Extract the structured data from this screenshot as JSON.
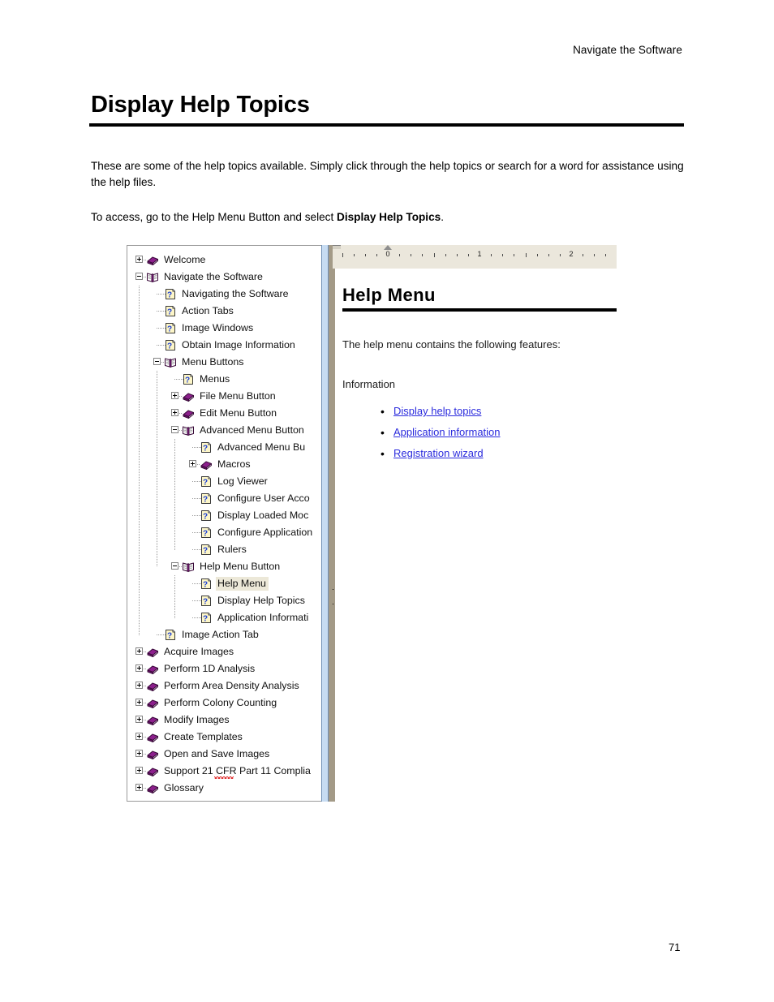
{
  "header": {
    "running_head": "Navigate the Software"
  },
  "title": "Display Help Topics",
  "paragraphs": {
    "intro": "These are some of the help topics available. Simply click through the help topics or search for a word for assistance using the help files.",
    "access_prefix": "To access, go to the Help Menu Button and select ",
    "access_bold": "Display Help Topics",
    "access_suffix": "."
  },
  "help_viewer": {
    "tree": {
      "items": [
        {
          "label": "Welcome",
          "depth": 0,
          "icon": "closed-book-icon",
          "expander": "plus",
          "selected": false
        },
        {
          "label": "Navigate the Software",
          "depth": 0,
          "icon": "open-book-icon",
          "expander": "minus",
          "selected": false
        },
        {
          "label": "Navigating the Software",
          "depth": 1,
          "icon": "help-page-icon",
          "expander": "none",
          "selected": false
        },
        {
          "label": "Action Tabs",
          "depth": 1,
          "icon": "help-page-icon",
          "expander": "none",
          "selected": false
        },
        {
          "label": "Image Windows",
          "depth": 1,
          "icon": "help-page-icon",
          "expander": "none",
          "selected": false
        },
        {
          "label": "Obtain Image Information",
          "depth": 1,
          "icon": "help-page-icon",
          "expander": "none",
          "selected": false
        },
        {
          "label": "Menu Buttons",
          "depth": 1,
          "icon": "open-book-icon",
          "expander": "minus",
          "selected": false
        },
        {
          "label": "Menus",
          "depth": 2,
          "icon": "help-page-icon",
          "expander": "none",
          "selected": false
        },
        {
          "label": "File Menu Button",
          "depth": 2,
          "icon": "closed-book-icon",
          "expander": "plus",
          "selected": false
        },
        {
          "label": "Edit Menu Button",
          "depth": 2,
          "icon": "closed-book-icon",
          "expander": "plus",
          "selected": false
        },
        {
          "label": "Advanced Menu Button",
          "depth": 2,
          "icon": "open-book-icon",
          "expander": "minus",
          "selected": false
        },
        {
          "label": "Advanced Menu Bu",
          "depth": 3,
          "icon": "help-page-icon",
          "expander": "none",
          "selected": false
        },
        {
          "label": "Macros",
          "depth": 3,
          "icon": "closed-book-icon",
          "expander": "plus",
          "selected": false
        },
        {
          "label": "Log Viewer",
          "depth": 3,
          "icon": "help-page-icon",
          "expander": "none",
          "selected": false
        },
        {
          "label": "Configure User Acco",
          "depth": 3,
          "icon": "help-page-icon",
          "expander": "none",
          "selected": false
        },
        {
          "label": "Display Loaded Moc",
          "depth": 3,
          "icon": "help-page-icon",
          "expander": "none",
          "selected": false
        },
        {
          "label": "Configure Application",
          "depth": 3,
          "icon": "help-page-icon",
          "expander": "none",
          "selected": false
        },
        {
          "label": "Rulers",
          "depth": 3,
          "icon": "help-page-icon",
          "expander": "none",
          "selected": false
        },
        {
          "label": "Help Menu Button",
          "depth": 2,
          "icon": "open-book-icon",
          "expander": "minus",
          "selected": false
        },
        {
          "label": "Help Menu",
          "depth": 3,
          "icon": "help-page-icon",
          "expander": "none",
          "selected": true
        },
        {
          "label": "Display Help Topics",
          "depth": 3,
          "icon": "help-page-icon",
          "expander": "none",
          "selected": false
        },
        {
          "label": "Application Informati",
          "depth": 3,
          "icon": "help-page-icon",
          "expander": "none",
          "selected": false
        },
        {
          "label": "Image Action Tab",
          "depth": 1,
          "icon": "help-page-icon",
          "expander": "none",
          "selected": false
        },
        {
          "label": "Acquire Images",
          "depth": 0,
          "icon": "closed-book-icon",
          "expander": "plus",
          "selected": false
        },
        {
          "label": "Perform 1D Analysis",
          "depth": 0,
          "icon": "closed-book-icon",
          "expander": "plus",
          "selected": false
        },
        {
          "label": "Perform Area Density Analysis",
          "depth": 0,
          "icon": "closed-book-icon",
          "expander": "plus",
          "selected": false
        },
        {
          "label": "Perform Colony Counting",
          "depth": 0,
          "icon": "closed-book-icon",
          "expander": "plus",
          "selected": false
        },
        {
          "label": "Modify Images",
          "depth": 0,
          "icon": "closed-book-icon",
          "expander": "plus",
          "selected": false
        },
        {
          "label": "Create Templates",
          "depth": 0,
          "icon": "closed-book-icon",
          "expander": "plus",
          "selected": false
        },
        {
          "label": "Open and Save Images",
          "depth": 0,
          "icon": "closed-book-icon",
          "expander": "plus",
          "selected": false
        },
        {
          "label": "Support 21 CFR Part 11 Complia",
          "depth": 0,
          "icon": "closed-book-icon",
          "expander": "plus",
          "selected": false,
          "spellerror": true
        },
        {
          "label": "Glossary",
          "depth": 0,
          "icon": "closed-book-icon",
          "expander": "plus",
          "selected": false
        }
      ]
    },
    "ruler": {
      "numbers": [
        "0",
        "1",
        "2"
      ]
    },
    "content": {
      "heading": "Help Menu",
      "lead": "The help menu contains the following features:",
      "section_label": "Information",
      "links": [
        "Display help topics",
        "Application information",
        "Registration wizard"
      ]
    }
  },
  "footer": {
    "page_number": "71"
  },
  "colors": {
    "link": "#2b2bdd",
    "selection": "#ece8d8",
    "splitter": "#c7dcf2",
    "ruler_bg": "#ebe7dc",
    "book_purple": "#8c1f8c"
  }
}
